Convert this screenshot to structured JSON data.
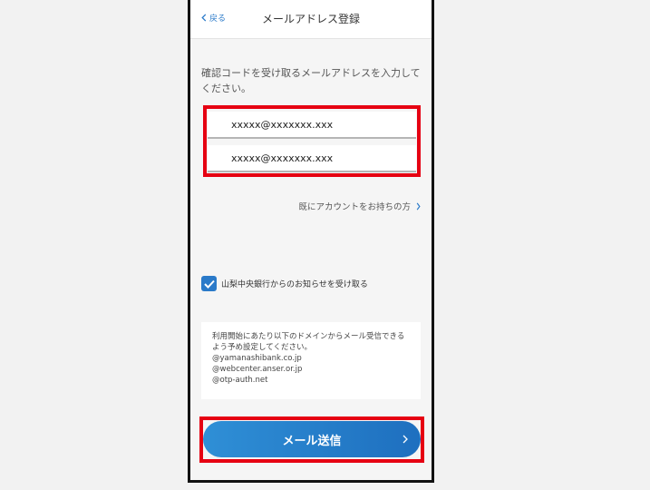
{
  "header": {
    "back_label": "戻る",
    "title": "メールアドレス登録"
  },
  "form": {
    "instruction": "確認コードを受け取るメールアドレスを入力してください。",
    "email_value": "xxxxx@xxxxxxx.xxx",
    "email_confirm_value": "xxxxx@xxxxxxx.xxx",
    "account_link_label": "既にアカウントをお持ちの方",
    "opt_in_label": "山梨中央銀行からのお知らせを受け取る",
    "opt_in_checked": true
  },
  "notice": {
    "text": "利用開始にあたり以下のドメインからメール受信できるよう予め設定してください。",
    "domains": [
      "@yamanashibank.co.jp",
      "@webcenter.anser.or.jp",
      "@otp-auth.net"
    ]
  },
  "actions": {
    "send_label": "メール送信"
  },
  "colors": {
    "accent": "#2a7ac9",
    "highlight": "#e60012",
    "button_gradient_start": "#2f8fd6",
    "button_gradient_end": "#1e6fbf"
  }
}
